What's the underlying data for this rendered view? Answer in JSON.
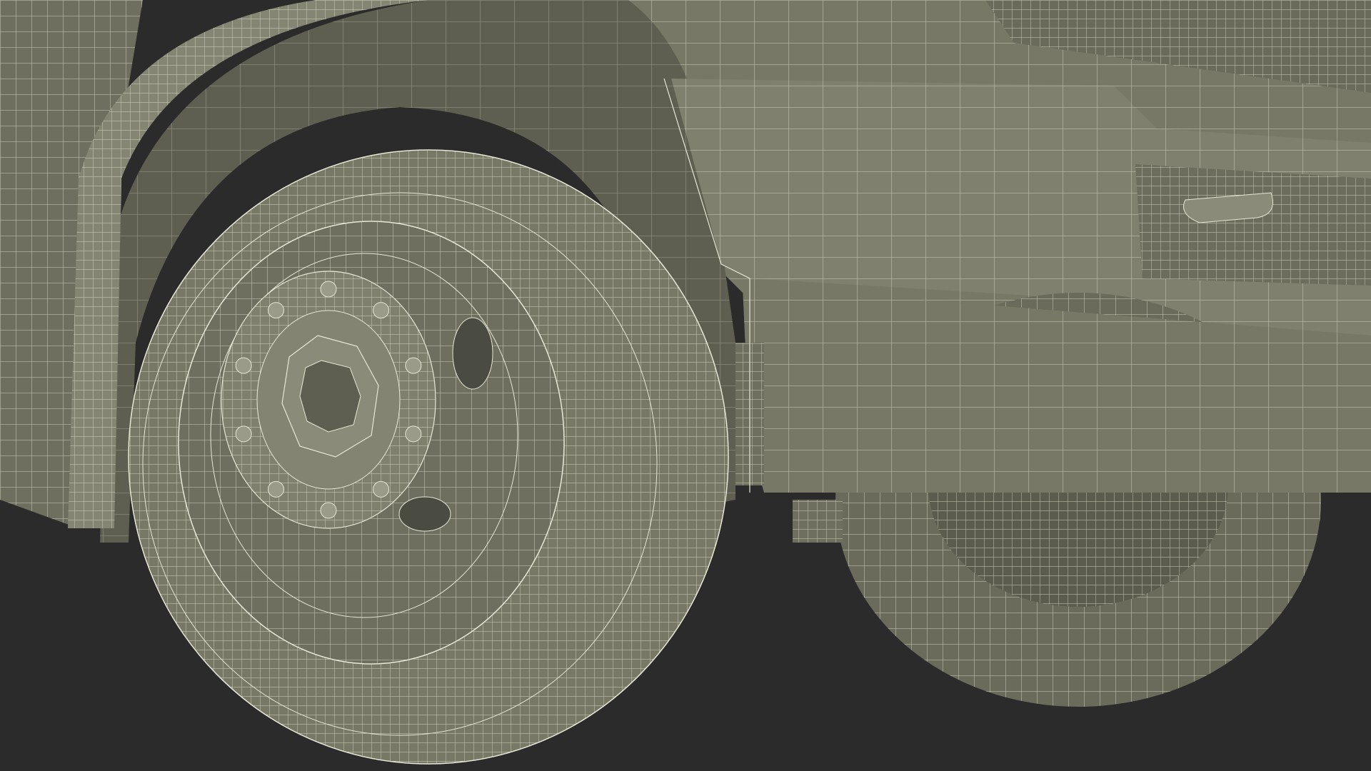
{
  "scene": {
    "subject": "wireframe-truck-front-wheels",
    "colors": {
      "background": "#2b2b2b",
      "surface": "#777866",
      "surface_dark": "#5e5f50",
      "surface_light": "#8a8b78",
      "shadow": "#4b4c41",
      "wire": "#e8e6d6"
    },
    "front_wheel": {
      "lug_nuts": 10,
      "hub_holes": 2
    },
    "rear_wheel": {
      "visible": true
    }
  }
}
